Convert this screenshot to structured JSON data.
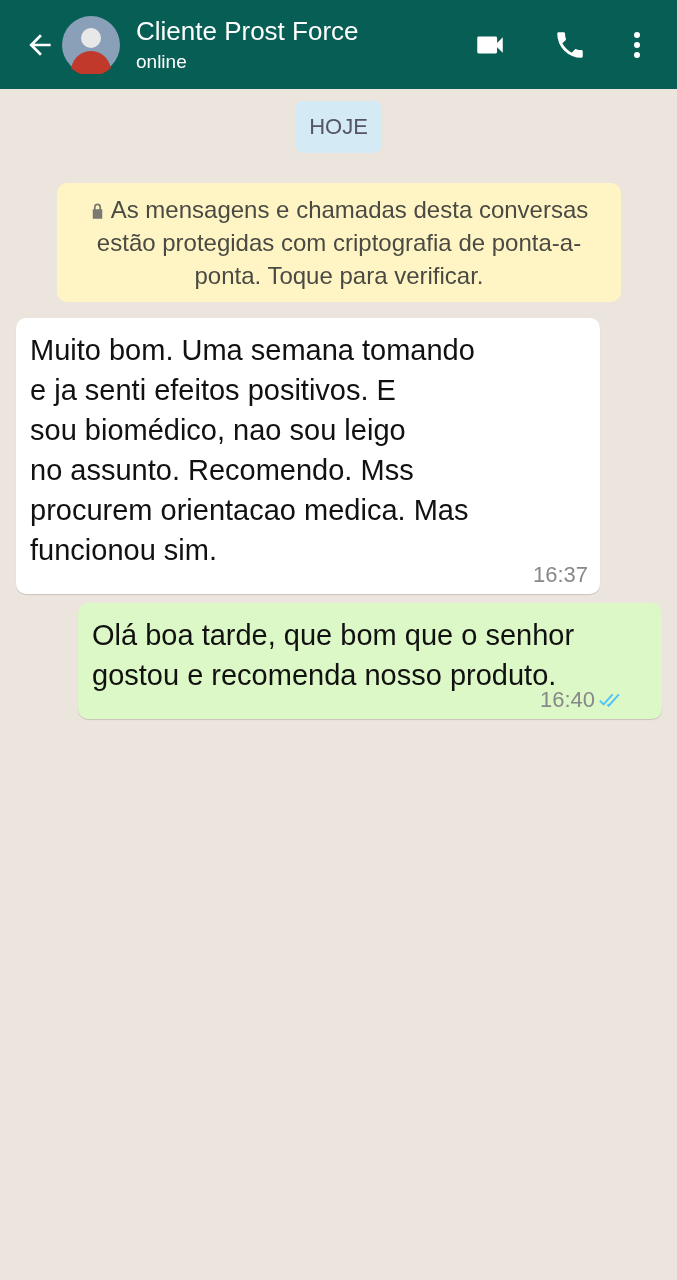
{
  "header": {
    "title": "Cliente Prost Force",
    "status": "online"
  },
  "date_chip": "HOJE",
  "encryption_notice": "As mensagens e chamadas desta conversas estão protegidas com criptografia de ponta-a-ponta. Toque para verificar.",
  "messages": [
    {
      "kind": "incoming",
      "text": "Muito bom. Uma semana tomando\ne ja senti efeitos positivos. E\nsou biomédico, nao sou leigo\nno assunto. Recomendo. Mss\nprocurem orientacao medica. Mas\nfuncionou sim.",
      "time": "16:37"
    },
    {
      "kind": "outgoing",
      "text": "Olá boa tarde, que bom que o senhor gostou e recomenda nosso produto.",
      "time": "16:40",
      "read": true
    }
  ]
}
